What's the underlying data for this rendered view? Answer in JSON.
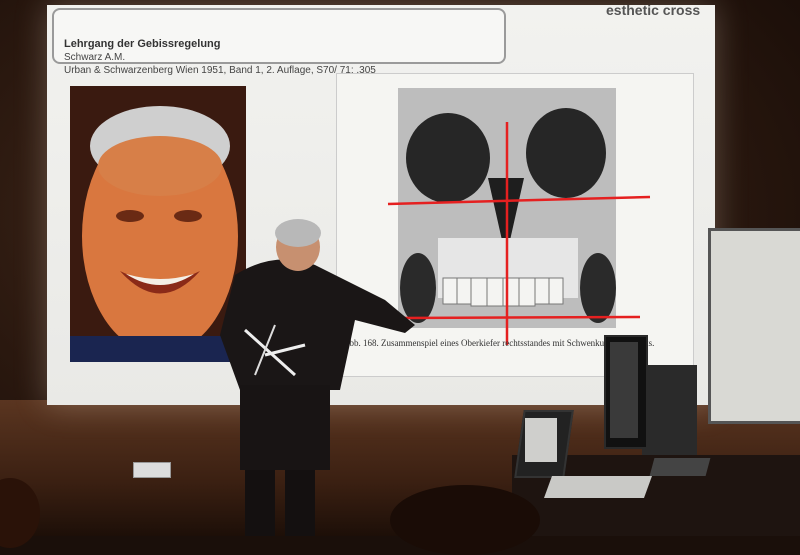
{
  "slide": {
    "brand": "esthetic cross",
    "reference": {
      "title": "Lehrgang der Gebissregelung",
      "author": "Schwarz A.M.",
      "publication": "Urban & Schwarzenberg Wien 1951, Band 1, 2. Auflage, S70/ 71; .305"
    },
    "figure_caption": "Abb. 168. Zusammenspiel eines Oberkiefer rechtsstandes mit Schwenkung nach links.",
    "accent_line_color": "#e52020"
  },
  "scene": {
    "room_colors": {
      "wall": "#3a2214",
      "screen": "#eeeeeb"
    }
  }
}
